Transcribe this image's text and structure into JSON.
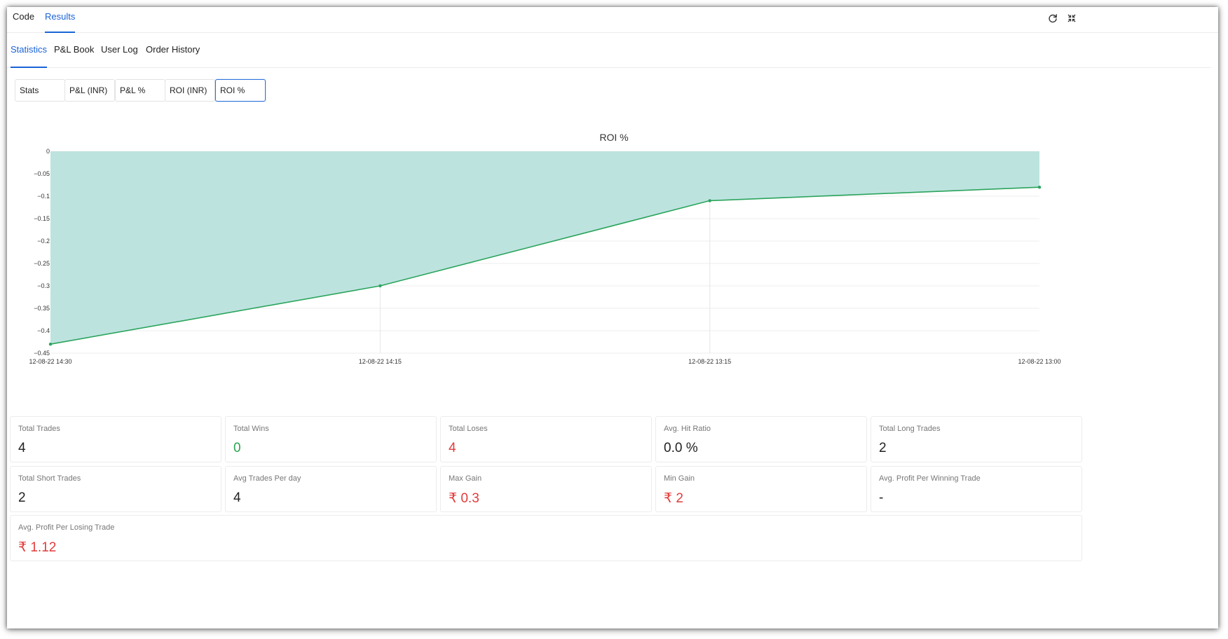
{
  "top_tabs": [
    {
      "label": "Code",
      "active": false
    },
    {
      "label": "Results",
      "active": true
    }
  ],
  "toolbar": {
    "refresh_icon": "refresh-icon",
    "collapse_icon": "collapse-icon"
  },
  "sub_tabs": [
    {
      "label": "Statistics",
      "active": true
    },
    {
      "label": "P&L Book",
      "active": false
    },
    {
      "label": "User Log",
      "active": false
    },
    {
      "label": "Order History",
      "active": false
    }
  ],
  "segments": [
    {
      "label": "Stats",
      "active": false
    },
    {
      "label": "P&L (INR)",
      "active": false
    },
    {
      "label": "P&L %",
      "active": false
    },
    {
      "label": "ROI (INR)",
      "active": false
    },
    {
      "label": "ROI %",
      "active": true
    }
  ],
  "chart_data": {
    "type": "area",
    "title": "ROI %",
    "x": [
      "12-08-22 14:30",
      "12-08-22 14:15",
      "12-08-22 13:15",
      "12-08-22 13:00"
    ],
    "series": [
      {
        "values": [
          -0.43,
          -0.3,
          -0.11,
          -0.08
        ]
      }
    ],
    "ylim": [
      -0.45,
      0
    ],
    "yticks": [
      0,
      -0.05,
      -0.1,
      -0.15,
      -0.2,
      -0.25,
      -0.3,
      -0.35,
      -0.4,
      -0.45
    ],
    "ytick_labels": [
      "0",
      "−0.05",
      "−0.1",
      "−0.15",
      "−0.2",
      "−0.25",
      "−0.3",
      "−0.35",
      "−0.4",
      "−0.45"
    ],
    "grid": true,
    "fill_color": "#bde3df",
    "line_color": "#2aa45c"
  },
  "stats": [
    {
      "label": "Total Trades",
      "value": "4",
      "tone": "default"
    },
    {
      "label": "Total Wins",
      "value": "0",
      "tone": "green"
    },
    {
      "label": "Total Loses",
      "value": "4",
      "tone": "red"
    },
    {
      "label": "Avg. Hit Ratio",
      "value": "0.0 %",
      "tone": "default"
    },
    {
      "label": "Total Long Trades",
      "value": "2",
      "tone": "default"
    },
    {
      "label": "Total Short Trades",
      "value": "2",
      "tone": "default"
    },
    {
      "label": "Avg Trades Per day",
      "value": "4",
      "tone": "default"
    },
    {
      "label": "Max Gain",
      "value": "₹ 0.3",
      "tone": "red"
    },
    {
      "label": "Min Gain",
      "value": "₹ 2",
      "tone": "red"
    },
    {
      "label": "Avg. Profit Per Winning Trade",
      "value": "-",
      "tone": "default"
    },
    {
      "label": "Avg. Profit Per Losing Trade",
      "value": "₹ 1.12",
      "tone": "red"
    }
  ]
}
